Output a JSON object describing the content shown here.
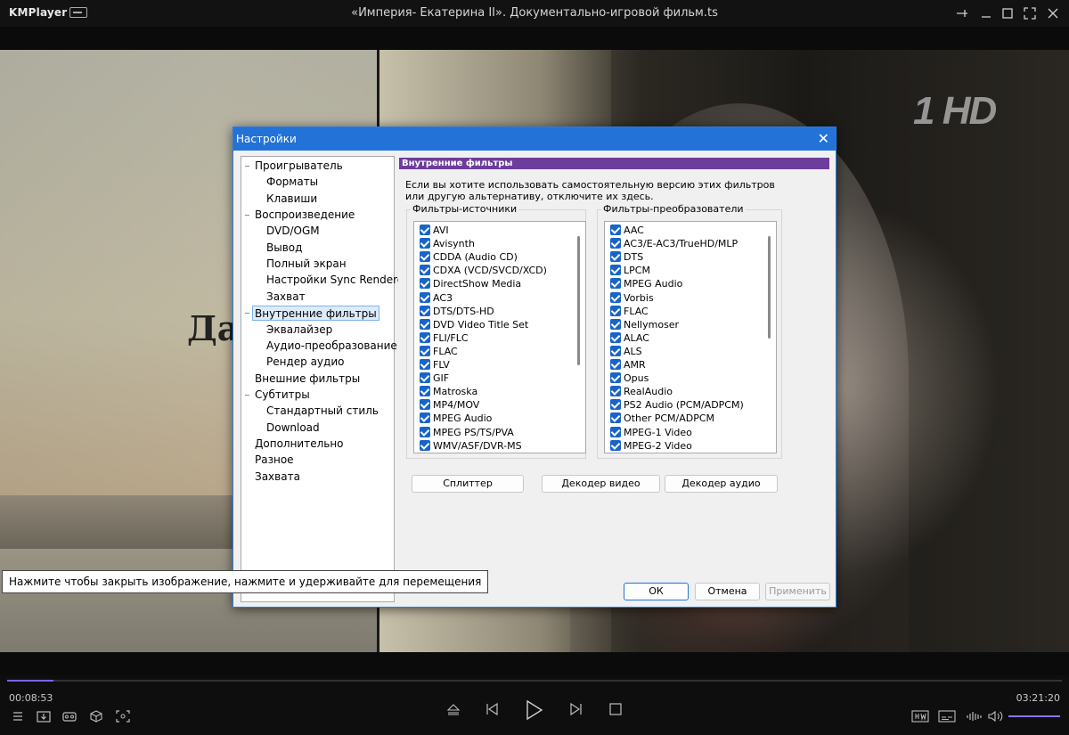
{
  "titlebar": {
    "app_name": "KMPlayer",
    "title": "«Империя- Екатерина II». Документально-игровой фильм.ts",
    "icons": [
      "pin-icon",
      "minimize-icon",
      "maximize-icon",
      "fullscreen-icon",
      "close-icon"
    ]
  },
  "video": {
    "overlay_text": "Да",
    "channel_logo": "1 HD"
  },
  "tooltip": "Нажмите чтобы закрыть изображение, нажмите и удерживайте для перемещения",
  "dialog": {
    "title": "Настройки",
    "tree": [
      {
        "label": "Проигрыватель",
        "level": 0,
        "expander": "−"
      },
      {
        "label": "Форматы",
        "level": 1
      },
      {
        "label": "Клавиши",
        "level": 1
      },
      {
        "label": "Воспроизведение",
        "level": 0,
        "expander": "−"
      },
      {
        "label": "DVD/OGM",
        "level": 1
      },
      {
        "label": "Вывод",
        "level": 1
      },
      {
        "label": "Полный экран",
        "level": 1
      },
      {
        "label": "Настройки Sync Renderer",
        "level": 1
      },
      {
        "label": "Захват",
        "level": 1
      },
      {
        "label": "Внутренние фильтры",
        "level": 0,
        "expander": "−",
        "selected": true
      },
      {
        "label": "Эквалайзер",
        "level": 1
      },
      {
        "label": "Аудио-преобразование",
        "level": 1
      },
      {
        "label": "Рендер аудио",
        "level": 1
      },
      {
        "label": "Внешние фильтры",
        "level": 0
      },
      {
        "label": "Субтитры",
        "level": 0,
        "expander": "−"
      },
      {
        "label": "Стандартный стиль",
        "level": 1
      },
      {
        "label": "Download",
        "level": 1
      },
      {
        "label": "Дополнительно",
        "level": 0
      },
      {
        "label": "Разное",
        "level": 0
      },
      {
        "label": "Захвата",
        "level": 0
      }
    ],
    "panel": {
      "heading": "Внутренние фильтры",
      "description": "Если вы хотите использовать самостоятельную версию этих фильтров или другую альтернативу, отключите их здесь.",
      "sources": {
        "label": "Фильтры-источники",
        "items": [
          "AVI",
          "Avisynth",
          "CDDA (Audio CD)",
          "CDXA (VCD/SVCD/XCD)",
          "DirectShow Media",
          "AC3",
          "DTS/DTS-HD",
          "DVD Video Title Set",
          "FLI/FLC",
          "FLAC",
          "FLV",
          "GIF",
          "Matroska",
          "MP4/MOV",
          "MPEG Audio",
          "MPEG PS/TS/PVA",
          "WMV/ASF/DVR-MS"
        ]
      },
      "transforms": {
        "label": "Фильтры-преобразователи",
        "items": [
          "AAC",
          "AC3/E-AC3/TrueHD/MLP",
          "DTS",
          "LPCM",
          "MPEG Audio",
          "Vorbis",
          "FLAC",
          "Nellymoser",
          "ALAC",
          "ALS",
          "AMR",
          "Opus",
          "RealAudio",
          "PS2 Audio (PCM/ADPCM)",
          "Other PCM/ADPCM",
          "MPEG-1 Video",
          "MPEG-2 Video"
        ]
      },
      "buttons": {
        "splitter": "Сплиттер",
        "video_decoder": "Декодер видео",
        "audio_decoder": "Декодер аудио"
      }
    },
    "footer": {
      "ok": "ОК",
      "cancel": "Отмена",
      "apply": "Применить"
    }
  },
  "controls": {
    "elapsed": "00:08:53",
    "total": "03:21:20",
    "progress_fraction": 0.044,
    "volume_fraction": 1.0,
    "accent_color": "#7a63ff"
  }
}
